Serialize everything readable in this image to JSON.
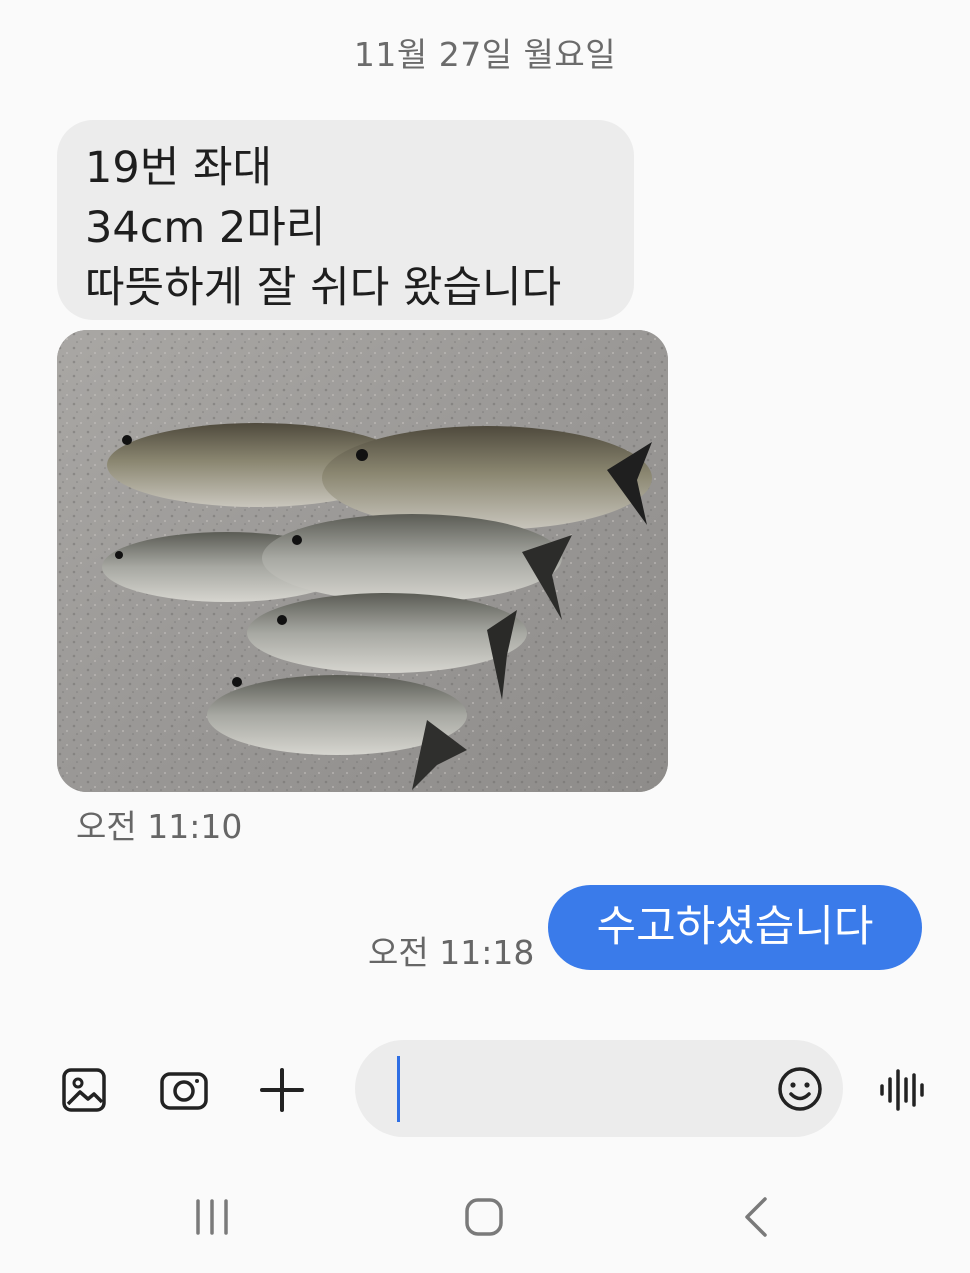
{
  "conversation": {
    "date_separator": "11월 27일 월요일",
    "incoming": {
      "lines": [
        "19번 좌대",
        "34cm 2마리",
        "따뜻하게 잘 쉬다 왔습니다"
      ],
      "photo_icon": "photo-of-fish-catch",
      "time": "오전 11:10"
    },
    "outgoing": {
      "text": "수고하셨습니다",
      "time": "오전 11:18"
    }
  },
  "composer": {
    "gallery_icon": "image-icon",
    "camera_icon": "camera-icon",
    "add_icon": "plus-icon",
    "input_value": "",
    "input_placeholder": "",
    "emoji_icon": "smiley-icon",
    "voice_icon": "voice-wave-icon"
  },
  "navigation": {
    "recents_icon": "recent-apps-icon",
    "home_icon": "home-icon",
    "back_icon": "back-icon"
  },
  "colors": {
    "outgoing_bubble": "#3a7bea",
    "incoming_bubble": "#ececec",
    "background": "#fafafa",
    "caret": "#2f6fe4"
  }
}
